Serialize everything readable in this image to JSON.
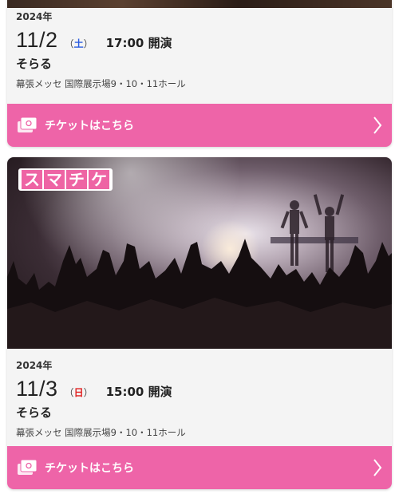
{
  "events": [
    {
      "year": "2024年",
      "date": "11/2",
      "dow_open": "（",
      "dow": "土",
      "dow_close": "）",
      "time": "17:00 開演",
      "artist": "そらる",
      "venue": "幕張メッセ 国際展示場9・10・11ホール",
      "ticket_label": "チケットはこちら"
    },
    {
      "year": "2024年",
      "date": "11/3",
      "dow_open": "（",
      "dow": "日",
      "dow_close": "）",
      "time": "15:00 開演",
      "artist": "そらる",
      "venue": "幕張メッセ 国際展示場9・10・11ホール",
      "ticket_label": "チケットはこちら"
    }
  ],
  "logo": {
    "chars": [
      "ス",
      "マ",
      "チ",
      "ケ"
    ]
  },
  "colors": {
    "accent": "#ee64a8",
    "saturday": "#2c5ee0",
    "sunday": "#e02020"
  }
}
